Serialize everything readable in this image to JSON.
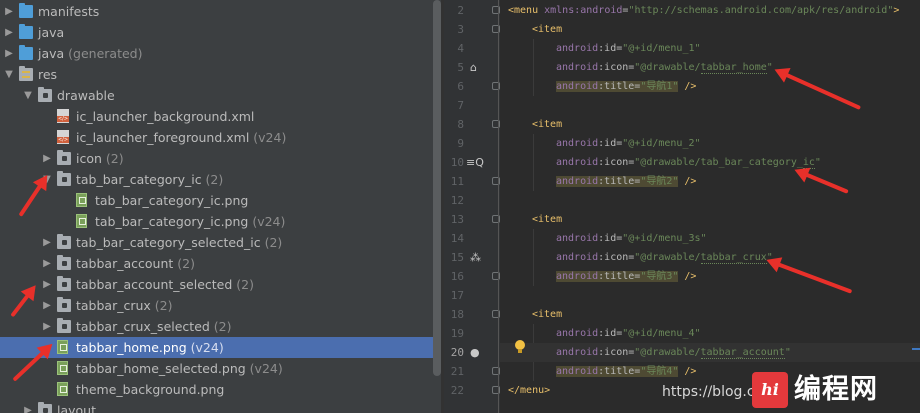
{
  "project_tree": {
    "items": [
      {
        "label": "manifests",
        "count": "",
        "suffix": "",
        "indent": 0,
        "expanded": false,
        "icon": "folder-icon",
        "color": "#4f9ed8"
      },
      {
        "label": "java",
        "count": "",
        "suffix": "",
        "indent": 0,
        "expanded": false,
        "icon": "folder-icon",
        "color": "#4f9ed8"
      },
      {
        "label": "java",
        "count": "",
        "suffix": "(generated)",
        "indent": 0,
        "expanded": false,
        "icon": "folder-icon",
        "color": "#4f9ed8"
      },
      {
        "label": "res",
        "count": "",
        "suffix": "",
        "indent": 0,
        "expanded": true,
        "icon": "res-folder-icon"
      },
      {
        "label": "drawable",
        "count": "",
        "suffix": "",
        "indent": 1,
        "expanded": true,
        "icon": "folder-icon"
      },
      {
        "label": "ic_launcher_background.xml",
        "count": "",
        "suffix": "",
        "indent": 2,
        "icon": "xml-file-icon"
      },
      {
        "label": "ic_launcher_foreground.xml",
        "count": "(v24)",
        "suffix": "",
        "indent": 2,
        "icon": "xml-file-icon"
      },
      {
        "label": "icon",
        "count": "(2)",
        "suffix": "",
        "indent": 2,
        "expanded": false,
        "icon": "folder-icon"
      },
      {
        "label": "tab_bar_category_ic",
        "count": "(2)",
        "suffix": "",
        "indent": 2,
        "expanded": true,
        "icon": "folder-icon"
      },
      {
        "label": "tab_bar_category_ic.png",
        "count": "",
        "suffix": "",
        "indent": 3,
        "icon": "png-file-icon"
      },
      {
        "label": "tab_bar_category_ic.png",
        "count": "(v24)",
        "suffix": "",
        "indent": 3,
        "icon": "png-file-icon"
      },
      {
        "label": "tab_bar_category_selected_ic",
        "count": "(2)",
        "suffix": "",
        "indent": 2,
        "expanded": false,
        "icon": "folder-icon"
      },
      {
        "label": "tabbar_account",
        "count": "(2)",
        "suffix": "",
        "indent": 2,
        "expanded": false,
        "icon": "folder-icon"
      },
      {
        "label": "tabbar_account_selected",
        "count": "(2)",
        "suffix": "",
        "indent": 2,
        "expanded": false,
        "icon": "folder-icon"
      },
      {
        "label": "tabbar_crux",
        "count": "(2)",
        "suffix": "",
        "indent": 2,
        "expanded": false,
        "icon": "folder-icon"
      },
      {
        "label": "tabbar_crux_selected",
        "count": "(2)",
        "suffix": "",
        "indent": 2,
        "expanded": false,
        "icon": "folder-icon"
      },
      {
        "label": "tabbar_home.png",
        "count": "(v24)",
        "suffix": "",
        "indent": 2,
        "icon": "png-file-icon",
        "selected": true
      },
      {
        "label": "tabbar_home_selected.png",
        "count": "(v24)",
        "suffix": "",
        "indent": 2,
        "icon": "png-file-icon"
      },
      {
        "label": "theme_background.png",
        "count": "",
        "suffix": "",
        "indent": 2,
        "icon": "png-file-icon"
      },
      {
        "label": "layout",
        "count": "",
        "suffix": "",
        "indent": 1,
        "expanded": false,
        "icon": "folder-icon"
      }
    ]
  },
  "editor": {
    "line_numbers": [
      "2",
      "3",
      "4",
      "5",
      "6",
      "7",
      "8",
      "9",
      "10",
      "11",
      "12",
      "13",
      "14",
      "15",
      "16",
      "17",
      "18",
      "19",
      "20",
      "21",
      "22"
    ],
    "current_line": "20",
    "lines": [
      {
        "n": "2",
        "parts": [
          [
            "tag",
            "<menu "
          ],
          [
            "ns",
            "xmlns:android"
          ],
          [
            "attr",
            "="
          ],
          [
            "val",
            "\"http://schemas.android.com/apk/res/android\""
          ],
          [
            "tag",
            ">"
          ]
        ],
        "indent": 0
      },
      {
        "n": "3",
        "parts": [
          [
            "tag",
            "<item"
          ]
        ],
        "indent": 1
      },
      {
        "n": "4",
        "parts": [
          [
            "ns",
            "android"
          ],
          [
            "attr",
            ":id="
          ],
          [
            "val",
            "\"@+id/menu_1\""
          ]
        ],
        "indent": 2
      },
      {
        "n": "5",
        "parts": [
          [
            "ns",
            "android"
          ],
          [
            "attr",
            ":icon="
          ],
          [
            "val",
            "\"@drawable/"
          ],
          [
            "ref",
            "tabbar_home"
          ],
          [
            "val",
            "\""
          ]
        ],
        "indent": 2
      },
      {
        "n": "6",
        "parts": [
          [
            "hl:ns",
            "android"
          ],
          [
            "hl:attr",
            ":title="
          ],
          [
            "hl:val",
            "\"导航1\""
          ],
          [
            "tag",
            " />"
          ]
        ],
        "indent": 2
      },
      {
        "n": "7",
        "parts": [],
        "indent": 0
      },
      {
        "n": "8",
        "parts": [
          [
            "tag",
            "<item"
          ]
        ],
        "indent": 1
      },
      {
        "n": "9",
        "parts": [
          [
            "ns",
            "android"
          ],
          [
            "attr",
            ":id="
          ],
          [
            "val",
            "\"@+id/menu_2\""
          ]
        ],
        "indent": 2
      },
      {
        "n": "10",
        "parts": [
          [
            "ns",
            "android"
          ],
          [
            "attr",
            ":icon="
          ],
          [
            "val",
            "\"@drawable/tab_bar_category_"
          ],
          [
            "ref",
            "ic"
          ],
          [
            "val",
            "\""
          ]
        ],
        "indent": 2
      },
      {
        "n": "11",
        "parts": [
          [
            "hl:ns",
            "android"
          ],
          [
            "hl:attr",
            ":title="
          ],
          [
            "hl:val",
            "\"导航2\""
          ],
          [
            "tag",
            " />"
          ]
        ],
        "indent": 2
      },
      {
        "n": "12",
        "parts": [],
        "indent": 0
      },
      {
        "n": "13",
        "parts": [
          [
            "tag",
            "<item"
          ]
        ],
        "indent": 1
      },
      {
        "n": "14",
        "parts": [
          [
            "ns",
            "android"
          ],
          [
            "attr",
            ":id="
          ],
          [
            "val",
            "\"@+id/menu_3s\""
          ]
        ],
        "indent": 2
      },
      {
        "n": "15",
        "parts": [
          [
            "ns",
            "android"
          ],
          [
            "attr",
            ":icon="
          ],
          [
            "val",
            "\"@drawable/"
          ],
          [
            "ref",
            "tabbar_crux"
          ],
          [
            "val",
            "\""
          ]
        ],
        "indent": 2
      },
      {
        "n": "16",
        "parts": [
          [
            "hl:ns",
            "android"
          ],
          [
            "hl:attr",
            ":title="
          ],
          [
            "hl:val",
            "\"导航3\""
          ],
          [
            "tag",
            " />"
          ]
        ],
        "indent": 2
      },
      {
        "n": "17",
        "parts": [],
        "indent": 0
      },
      {
        "n": "18",
        "parts": [
          [
            "tag",
            "<item"
          ]
        ],
        "indent": 1
      },
      {
        "n": "19",
        "parts": [
          [
            "ns",
            "android"
          ],
          [
            "attr",
            ":id="
          ],
          [
            "val",
            "\"@+id/menu_4\""
          ]
        ],
        "indent": 2
      },
      {
        "n": "20",
        "parts": [
          [
            "ns",
            "android"
          ],
          [
            "attr",
            ":icon="
          ],
          [
            "val",
            "\"@drawable/"
          ],
          [
            "ref",
            "tabbar_account"
          ],
          [
            "val",
            "\""
          ]
        ],
        "indent": 2
      },
      {
        "n": "21",
        "parts": [
          [
            "hl:ns",
            "android"
          ],
          [
            "hl:attr",
            ":title="
          ],
          [
            "hl:val",
            "\"导航4\""
          ],
          [
            "tag",
            " />"
          ]
        ],
        "indent": 2
      },
      {
        "n": "22",
        "parts": [
          [
            "tag",
            "</menu>"
          ]
        ],
        "indent": 0
      }
    ]
  },
  "gutter_icons": [
    {
      "line": "5",
      "icon": "home-icon",
      "glyph": "⌂"
    },
    {
      "line": "10",
      "icon": "category-search-icon",
      "glyph": "≡Q"
    },
    {
      "line": "15",
      "icon": "crux-icon",
      "glyph": "⁂"
    },
    {
      "line": "20",
      "icon": "account-icon",
      "glyph": "●"
    }
  ],
  "watermark": {
    "url": "https://blog.csdn.",
    "logo_text": "hi",
    "site_text": "编程网"
  },
  "colors": {
    "arrow": "#e8302a",
    "selection": "#4b6eaf"
  }
}
